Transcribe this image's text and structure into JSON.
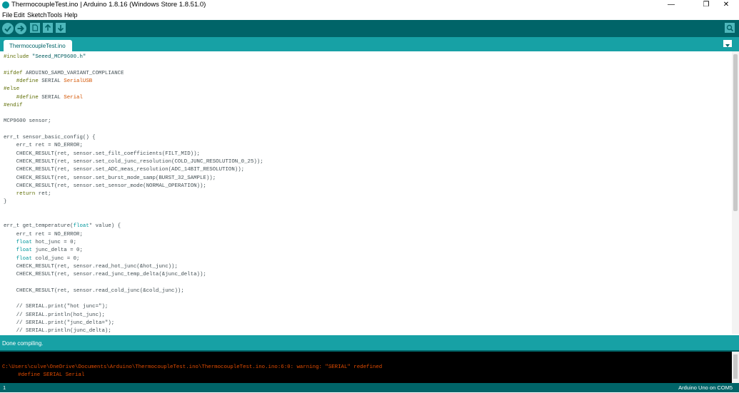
{
  "window": {
    "title": "ThermocoupleTest.ino | Arduino 1.8.16 (Windows Store 1.8.51.0)",
    "controls": {
      "minimize": "—",
      "maximize": "❐",
      "close": "✕"
    }
  },
  "menu": {
    "items": [
      {
        "label": "File"
      },
      {
        "label": "Edit"
      },
      {
        "label": "Sketch"
      },
      {
        "label": "Tools"
      },
      {
        "label": "Help"
      }
    ]
  },
  "toolbar": {
    "buttons": [
      {
        "icon": "verify-icon"
      },
      {
        "icon": "upload-icon"
      },
      {
        "icon": "new-sketch-icon"
      },
      {
        "icon": "open-sketch-icon"
      },
      {
        "icon": "save-sketch-icon"
      }
    ],
    "serial_monitor_icon": "serial-monitor-icon"
  },
  "tabs": [
    {
      "label": "ThermocoupleTest.ino"
    }
  ],
  "colors": {
    "toolbar": "#006468",
    "tabbar": "#17a1a5",
    "keyword": "#5e6d03",
    "type": "#00979c",
    "function": "#d35400",
    "comment": "#434f54",
    "console_text": "#e34c00"
  },
  "editor": {
    "lines": [
      {
        "seg": [
          {
            "t": "#include ",
            "c": "#5e6d03"
          },
          {
            "t": "\"Seeed_MCP9600.h\"",
            "c": "#005c5f"
          }
        ]
      },
      {
        "seg": []
      },
      {
        "seg": [
          {
            "t": "#ifdef ",
            "c": "#5e6d03"
          },
          {
            "t": "ARDUINO_SAMD_VARIANT_COMPLIANCE",
            "c": "#434f54"
          }
        ]
      },
      {
        "seg": [
          {
            "t": "    #define ",
            "c": "#5e6d03"
          },
          {
            "t": "SERIAL ",
            "c": "#434f54"
          },
          {
            "t": "SerialUSB",
            "c": "#d35400"
          }
        ]
      },
      {
        "seg": [
          {
            "t": "#else",
            "c": "#5e6d03"
          }
        ]
      },
      {
        "seg": [
          {
            "t": "    #define ",
            "c": "#5e6d03"
          },
          {
            "t": "SERIAL ",
            "c": "#434f54"
          },
          {
            "t": "Serial",
            "c": "#d35400"
          }
        ]
      },
      {
        "seg": [
          {
            "t": "#endif",
            "c": "#5e6d03"
          }
        ]
      },
      {
        "seg": []
      },
      {
        "seg": [
          {
            "t": "MCP9600 sensor;",
            "c": "#434f54"
          }
        ]
      },
      {
        "seg": []
      },
      {
        "seg": [
          {
            "t": "err_t sensor_basic_config() {",
            "c": "#434f54"
          }
        ]
      },
      {
        "seg": [
          {
            "t": "    err_t ret = NO_ERROR;",
            "c": "#434f54"
          }
        ]
      },
      {
        "seg": [
          {
            "t": "    CHECK_RESULT(ret, sensor.set_filt_coefficients(FILT_MID));",
            "c": "#434f54"
          }
        ]
      },
      {
        "seg": [
          {
            "t": "    CHECK_RESULT(ret, sensor.set_cold_junc_resolution(COLD_JUNC_RESOLUTION_0_25));",
            "c": "#434f54"
          }
        ]
      },
      {
        "seg": [
          {
            "t": "    CHECK_RESULT(ret, sensor.set_ADC_meas_resolution(ADC_14BIT_RESOLUTION));",
            "c": "#434f54"
          }
        ]
      },
      {
        "seg": [
          {
            "t": "    CHECK_RESULT(ret, sensor.set_burst_mode_samp(BURST_32_SAMPLE));",
            "c": "#434f54"
          }
        ]
      },
      {
        "seg": [
          {
            "t": "    CHECK_RESULT(ret, sensor.set_sensor_mode(NORMAL_OPERATION));",
            "c": "#434f54"
          }
        ]
      },
      {
        "seg": [
          {
            "t": "    ",
            "c": "#434f54"
          },
          {
            "t": "return",
            "c": "#5e6d03"
          },
          {
            "t": " ret;",
            "c": "#434f54"
          }
        ]
      },
      {
        "seg": [
          {
            "t": "}",
            "c": "#434f54"
          }
        ]
      },
      {
        "seg": []
      },
      {
        "seg": []
      },
      {
        "seg": [
          {
            "t": "err_t get_temperature(",
            "c": "#434f54"
          },
          {
            "t": "float",
            "c": "#00979c"
          },
          {
            "t": "* value) {",
            "c": "#434f54"
          }
        ]
      },
      {
        "seg": [
          {
            "t": "    err_t ret = NO_ERROR;",
            "c": "#434f54"
          }
        ]
      },
      {
        "seg": [
          {
            "t": "    ",
            "c": "#434f54"
          },
          {
            "t": "float",
            "c": "#00979c"
          },
          {
            "t": " hot_junc = 0;",
            "c": "#434f54"
          }
        ]
      },
      {
        "seg": [
          {
            "t": "    ",
            "c": "#434f54"
          },
          {
            "t": "float",
            "c": "#00979c"
          },
          {
            "t": " junc_delta = 0;",
            "c": "#434f54"
          }
        ]
      },
      {
        "seg": [
          {
            "t": "    ",
            "c": "#434f54"
          },
          {
            "t": "float",
            "c": "#00979c"
          },
          {
            "t": " cold_junc = 0;",
            "c": "#434f54"
          }
        ]
      },
      {
        "seg": [
          {
            "t": "    CHECK_RESULT(ret, sensor.read_hot_junc(&hot_junc));",
            "c": "#434f54"
          }
        ]
      },
      {
        "seg": [
          {
            "t": "    CHECK_RESULT(ret, sensor.read_junc_temp_delta(&junc_delta));",
            "c": "#434f54"
          }
        ]
      },
      {
        "seg": []
      },
      {
        "seg": [
          {
            "t": "    CHECK_RESULT(ret, sensor.read_cold_junc(&cold_junc));",
            "c": "#434f54"
          }
        ]
      },
      {
        "seg": []
      },
      {
        "seg": [
          {
            "t": "    // SERIAL.print(\"hot junc=\");",
            "c": "#434f54"
          }
        ]
      },
      {
        "seg": [
          {
            "t": "    // SERIAL.println(hot_junc);",
            "c": "#434f54"
          }
        ]
      },
      {
        "seg": [
          {
            "t": "    // SERIAL.print(\"junc_delta=\");",
            "c": "#434f54"
          }
        ]
      },
      {
        "seg": [
          {
            "t": "    // SERIAL.println(junc_delta);",
            "c": "#434f54"
          }
        ]
      }
    ]
  },
  "status": {
    "message": "Done compiling."
  },
  "console": {
    "lines": [
      "C:\\Users\\culve\\OneDrive\\Documents\\Arduino\\ThermocoupleTest.ino\\ThermocoupleTest.ino.ino:6:0: warning: \"SERIAL\" redefined",
      "     #define SERIAL Serial"
    ]
  },
  "footer": {
    "line_number": "1",
    "board": "Arduino Uno on COM5"
  }
}
